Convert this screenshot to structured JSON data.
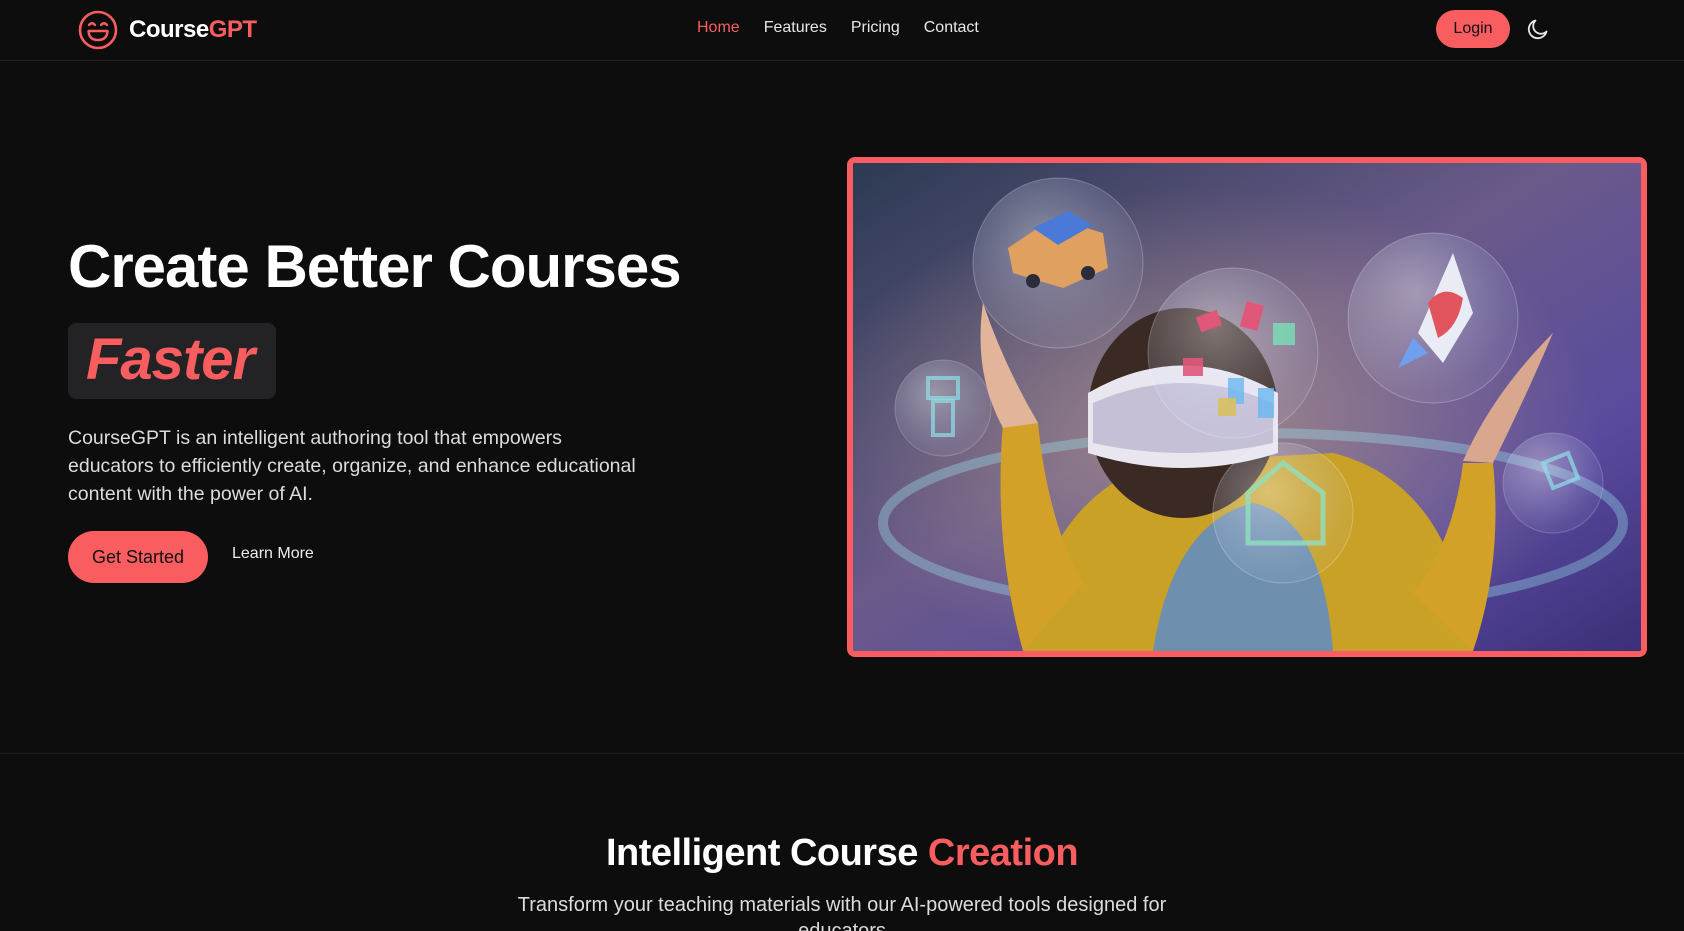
{
  "nav": {
    "brand_part1": "Course",
    "brand_part2": "GPT",
    "links": [
      "Home",
      "Features",
      "Pricing",
      "Contact"
    ],
    "active": "Home",
    "login_label": "Login",
    "theme_icon": "moon-icon",
    "logo_icon": "smiley-face-icon"
  },
  "hero": {
    "title": "Create Better Courses",
    "highlight": "Faster",
    "description": "CourseGPT is an intelligent authoring tool that empowers educators to efficiently create, organize, and enhance educational content with the power of AI.",
    "primary_cta": "Get Started",
    "secondary_cta": "Learn More",
    "image_icon": "vr-child-illustration"
  },
  "section": {
    "title_main": "Intelligent Course ",
    "title_accent": "Creation",
    "subtitle": "Transform your teaching materials with our AI-powered tools designed for educators"
  },
  "colors": {
    "accent": "#f95d5f",
    "background": "#0d0d0e",
    "surface": "#232325"
  }
}
